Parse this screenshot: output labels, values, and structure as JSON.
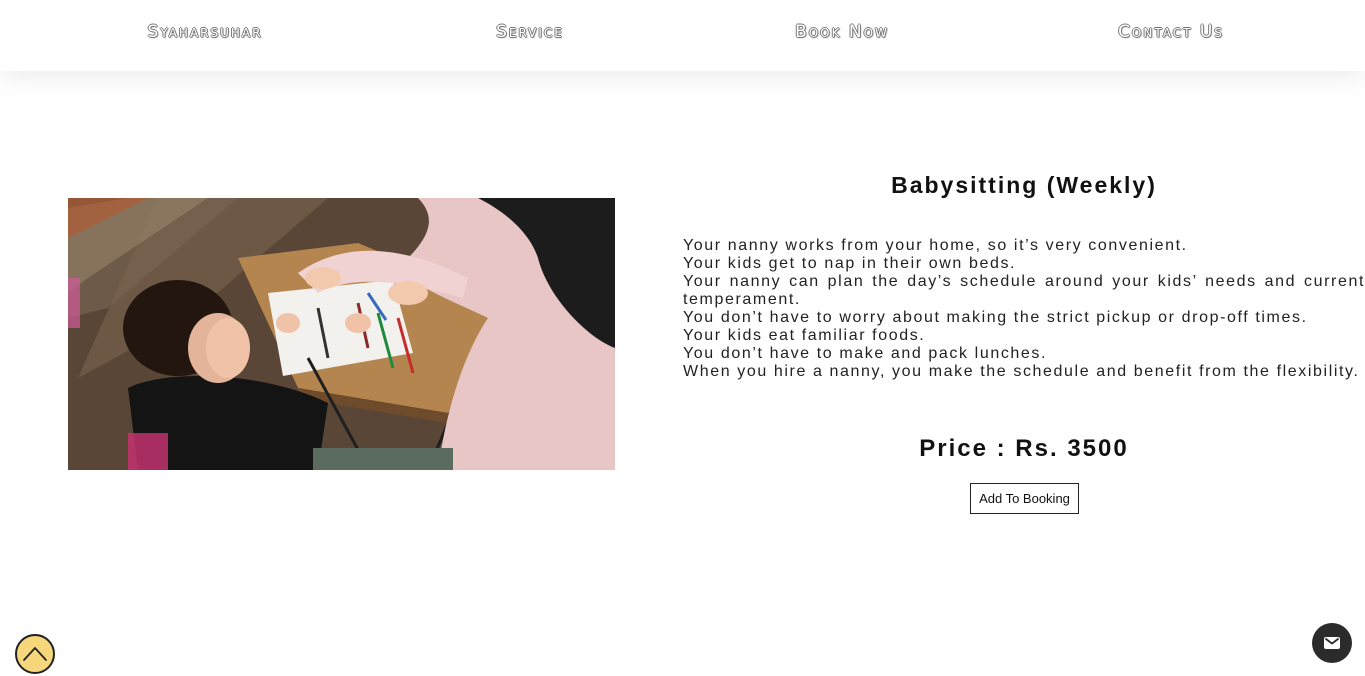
{
  "nav": {
    "brand": "Syaharsuhar",
    "service": "Service",
    "book_now": "Book Now",
    "contact_us": "Contact Us"
  },
  "product": {
    "image_icon": "photo-child-drawing-with-adult",
    "title": "Babysitting (Weekly)",
    "description_lines": [
      "Your nanny works from your home, so it’s very convenient.",
      "Your kids get to nap in their own beds.",
      "Your nanny can plan the day’s schedule around your kids’ needs and current temperament.",
      "You don’t have to worry about making the strict pickup or drop-off times.",
      "Your kids eat familiar foods.",
      "You don’t have to make and pack lunches.",
      "When you hire a nanny, you make the schedule and benefit from the flexibility."
    ],
    "price": "Price : Rs. 3500",
    "add_to_booking": "Add To Booking"
  },
  "floating": {
    "scroll_top_icon": "chevron-up-icon",
    "mail_icon": "mail-icon"
  },
  "colors": {
    "scroll_top_bg": "#f7d77c",
    "mail_bg": "#2b2b2b"
  }
}
